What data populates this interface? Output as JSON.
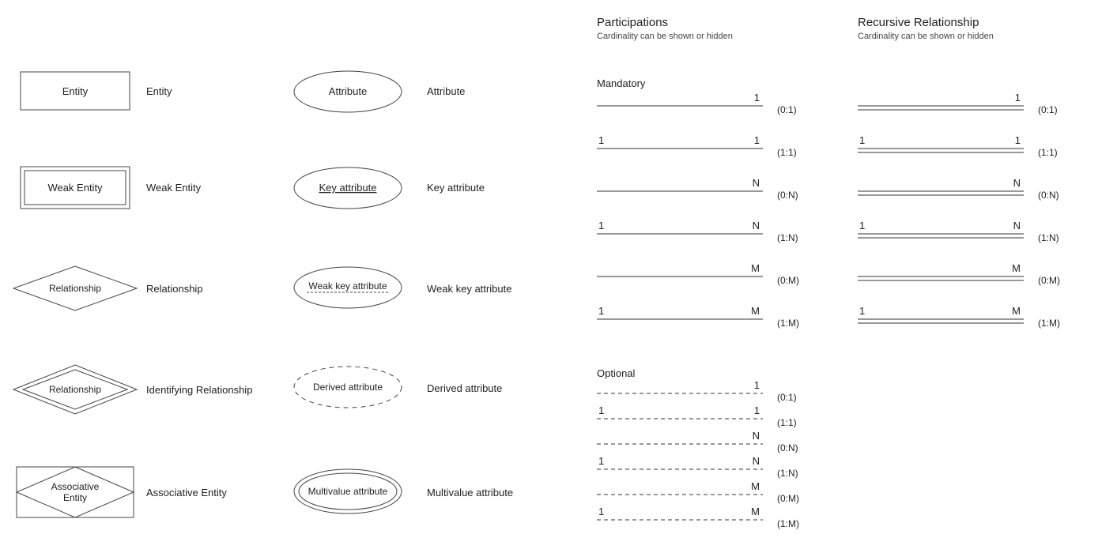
{
  "left": {
    "entity": {
      "shape": "Entity",
      "label": "Entity"
    },
    "weak_entity": {
      "shape": "Weak Entity",
      "label": "Weak Entity"
    },
    "relationship": {
      "shape": "Relationship",
      "label": "Relationship"
    },
    "identifying_relationship": {
      "shape": "Relationship",
      "label": "Identifying Relationship"
    },
    "associative_entity": {
      "shape": "Associative\nEntity",
      "label": "Associative Entity"
    },
    "attribute": {
      "shape": "Attribute",
      "label": "Attribute"
    },
    "key_attribute": {
      "shape": "Key attribute",
      "label": "Key attribute"
    },
    "weak_key_attribute": {
      "shape": "Weak key attribute",
      "label": "Weak key attribute"
    },
    "derived_attribute": {
      "shape": "Derived attribute",
      "label": "Derived attribute"
    },
    "multivalue_attribute": {
      "shape": "Multivalue attribute",
      "label": "Multivalue attribute"
    }
  },
  "participations": {
    "title": "Participations",
    "subtitle": "Cardinality can be shown or hidden",
    "mandatory": {
      "title": "Mandatory",
      "rows": [
        {
          "left": "",
          "right": "1",
          "card": "(0:1)"
        },
        {
          "left": "1",
          "right": "1",
          "card": "(1:1)"
        },
        {
          "left": "",
          "right": "N",
          "card": "(0:N)"
        },
        {
          "left": "1",
          "right": "N",
          "card": "(1:N)"
        },
        {
          "left": "",
          "right": "M",
          "card": "(0:M)"
        },
        {
          "left": "1",
          "right": "M",
          "card": "(1:M)"
        }
      ]
    },
    "optional": {
      "title": "Optional",
      "rows": [
        {
          "left": "",
          "right": "1",
          "card": "(0:1)"
        },
        {
          "left": "1",
          "right": "1",
          "card": "(1:1)"
        },
        {
          "left": "",
          "right": "N",
          "card": "(0:N)"
        },
        {
          "left": "1",
          "right": "N",
          "card": "(1:N)"
        },
        {
          "left": "",
          "right": "M",
          "card": "(0:M)"
        },
        {
          "left": "1",
          "right": "M",
          "card": "(1:M)"
        }
      ]
    }
  },
  "recursive": {
    "title": "Recursive Relationship",
    "subtitle": "Cardinality can be shown or hidden",
    "rows": [
      {
        "left": "",
        "right": "1",
        "card": "(0:1)"
      },
      {
        "left": "1",
        "right": "1",
        "card": "(1:1)"
      },
      {
        "left": "",
        "right": "N",
        "card": "(0:N)"
      },
      {
        "left": "1",
        "right": "N",
        "card": "(1:N)"
      },
      {
        "left": "",
        "right": "M",
        "card": "(0:M)"
      },
      {
        "left": "1",
        "right": "M",
        "card": "(1:M)"
      }
    ]
  }
}
